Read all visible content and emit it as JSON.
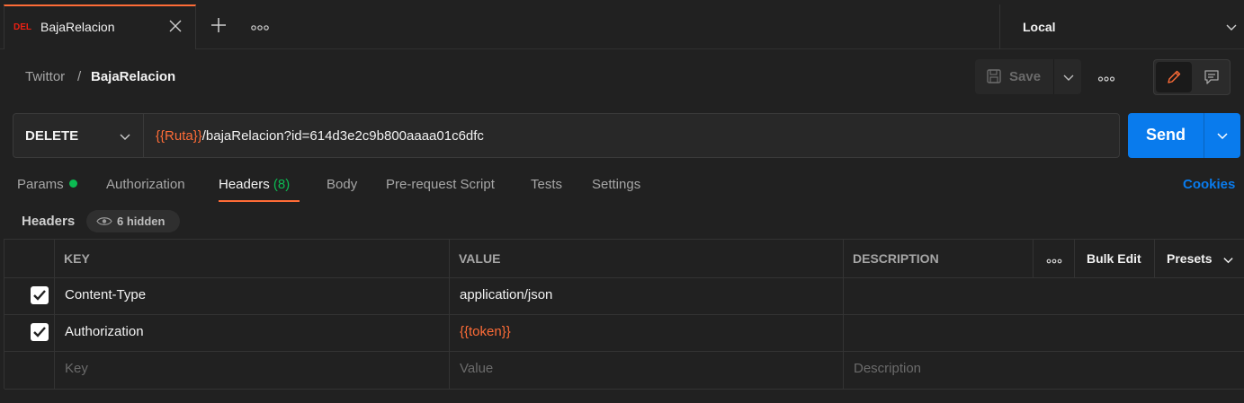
{
  "tabs": {
    "active": {
      "method_badge": "DEL",
      "name": "BajaRelacion"
    },
    "new_tab_icon": "plus-icon",
    "more_icon": "ellipsis-icon"
  },
  "environment": {
    "selected": "Local"
  },
  "breadcrumb": {
    "parent": "Twittor",
    "separator": "/",
    "current": "BajaRelacion"
  },
  "toolbar": {
    "save_label": "Save"
  },
  "request": {
    "method": "DELETE",
    "url_variable": "{{Ruta}}",
    "url_rest": "/bajaRelacion?id=614d3e2c9b800aaaa01c6dfc",
    "send_label": "Send"
  },
  "request_tabs": {
    "params": "Params",
    "authorization": "Authorization",
    "headers": "Headers",
    "headers_count": "(8)",
    "body": "Body",
    "pre_request": "Pre-request Script",
    "tests": "Tests",
    "settings": "Settings",
    "cookies": "Cookies"
  },
  "headers_section": {
    "title": "Headers",
    "hidden_label": "6 hidden"
  },
  "table": {
    "columns": {
      "key": "KEY",
      "value": "VALUE",
      "description": "DESCRIPTION"
    },
    "bulk_edit": "Bulk Edit",
    "presets": "Presets",
    "rows": [
      {
        "checked": true,
        "key": "Content-Type",
        "value": "application/json",
        "description": ""
      },
      {
        "checked": true,
        "key": "Authorization",
        "value": "{{token}}",
        "description": ""
      }
    ],
    "placeholders": {
      "key": "Key",
      "value": "Value",
      "description": "Description"
    }
  },
  "colors": {
    "accent": "#ff6c37",
    "primary": "#097bed",
    "success": "#0cbb52",
    "delete": "#eb2013"
  }
}
